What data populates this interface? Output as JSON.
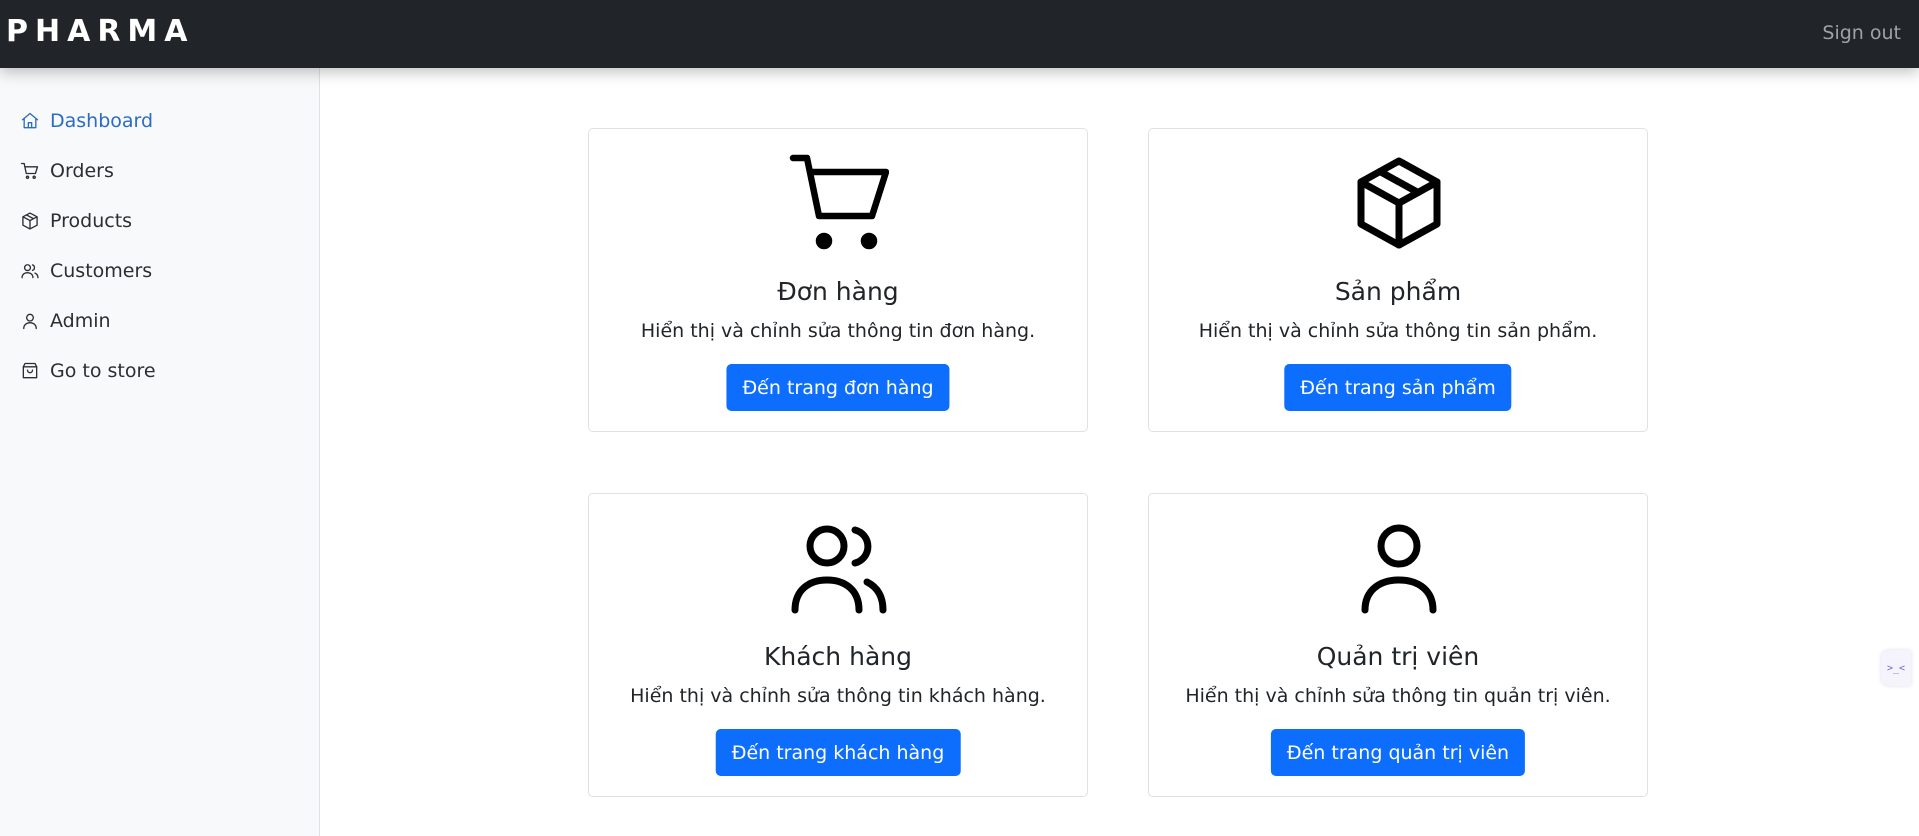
{
  "header": {
    "brand": "PHARMA",
    "sign_out_label": "Sign out"
  },
  "sidebar": {
    "items": [
      {
        "label": "Dashboard",
        "icon": "home-icon",
        "active": true
      },
      {
        "label": "Orders",
        "icon": "cart-icon",
        "active": false
      },
      {
        "label": "Products",
        "icon": "box-icon",
        "active": false
      },
      {
        "label": "Customers",
        "icon": "users-icon",
        "active": false
      },
      {
        "label": "Admin",
        "icon": "user-icon",
        "active": false
      },
      {
        "label": "Go to store",
        "icon": "shopping-bag-icon",
        "active": false
      }
    ]
  },
  "cards": [
    {
      "icon": "cart-icon",
      "title": "Đơn hàng",
      "text": "Hiển thị và chỉnh sửa thông tin đơn hàng.",
      "button": "Đến trang đơn hàng"
    },
    {
      "icon": "box-icon",
      "title": "Sản phẩm",
      "text": "Hiển thị và chỉnh sửa thông tin sản phẩm.",
      "button": "Đến trang sản phẩm"
    },
    {
      "icon": "users-icon",
      "title": "Khách hàng",
      "text": "Hiển thị và chỉnh sửa thông tin khách hàng.",
      "button": "Đến trang khách hàng"
    },
    {
      "icon": "user-icon",
      "title": "Quản trị viên",
      "text": "Hiển thị và chỉnh sửa thông tin quản trị viên.",
      "button": "Đến trang quản trị viên"
    }
  ],
  "floater": {
    "label": ">_<",
    "icon": "assistant-icon"
  },
  "colors": {
    "accent": "#0d6efd",
    "active_nav": "#2b6cc4",
    "topbar": "#212529",
    "sidebar": "#f8f9fa"
  }
}
